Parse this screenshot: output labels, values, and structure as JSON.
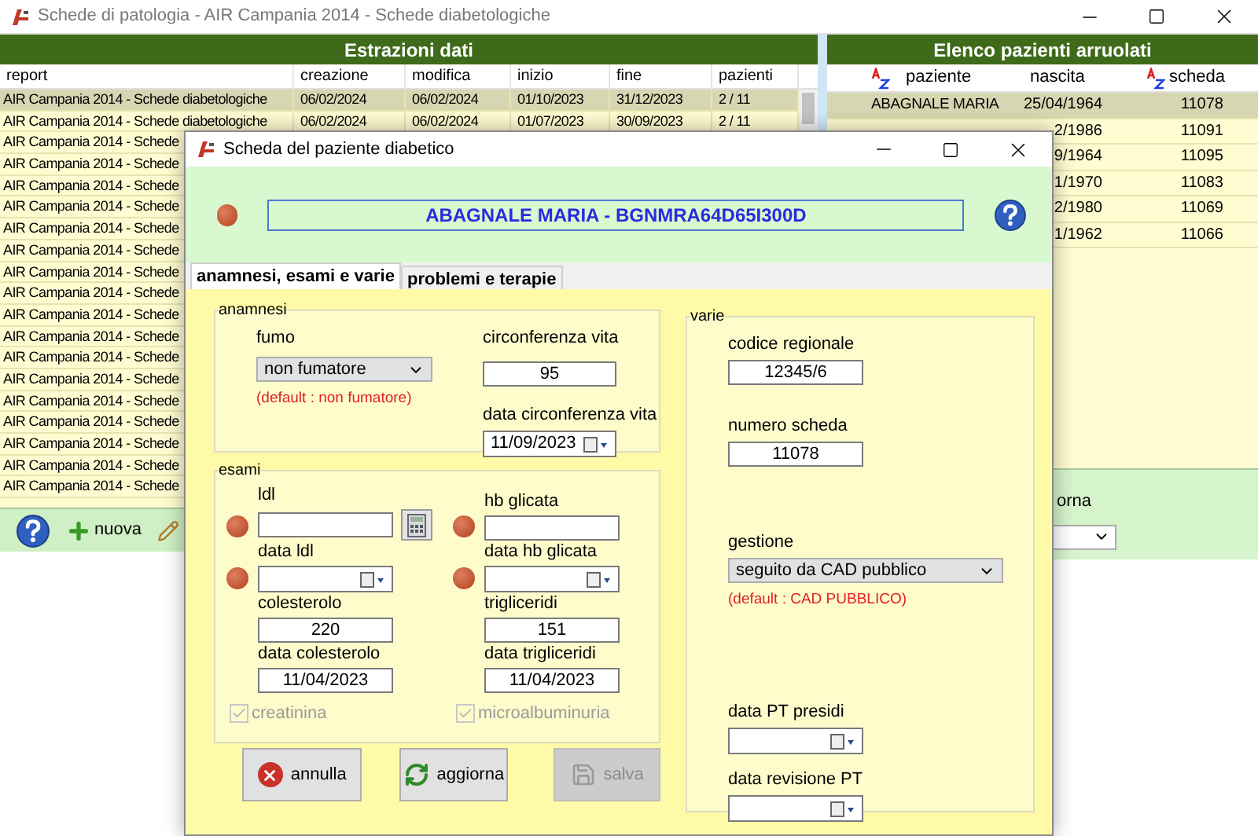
{
  "window": {
    "title": "Schede di patologia - AIR Campania 2014 - Schede diabetologiche"
  },
  "extractions": {
    "title": "Estrazioni dati",
    "columns": [
      "report",
      "creazione",
      "modifica",
      "inizio",
      "fine",
      "pazienti"
    ],
    "rows": [
      {
        "selected": true,
        "cells": [
          "AIR Campania 2014 - Schede diabetologiche",
          "06/02/2024",
          "06/02/2024",
          "01/10/2023",
          "31/12/2023",
          "2 / 11"
        ]
      },
      {
        "selected": false,
        "cells": [
          "AIR Campania 2014 - Schede diabetologiche",
          "06/02/2024",
          "06/02/2024",
          "01/07/2023",
          "30/09/2023",
          "2 / 11"
        ]
      },
      {
        "selected": false,
        "cells": [
          "AIR Campania 2014 - Schede"
        ]
      },
      {
        "selected": false,
        "cells": [
          "AIR Campania 2014 - Schede"
        ]
      },
      {
        "selected": false,
        "cells": [
          "AIR Campania 2014 - Schede"
        ]
      },
      {
        "selected": false,
        "cells": [
          "AIR Campania 2014 - Schede"
        ]
      },
      {
        "selected": false,
        "cells": [
          "AIR Campania 2014 - Schede"
        ]
      },
      {
        "selected": false,
        "cells": [
          "AIR Campania 2014 - Schede"
        ]
      },
      {
        "selected": false,
        "cells": [
          "AIR Campania 2014 - Schede"
        ]
      },
      {
        "selected": false,
        "cells": [
          "AIR Campania 2014 - Schede"
        ]
      },
      {
        "selected": false,
        "cells": [
          "AIR Campania 2014 - Schede"
        ]
      },
      {
        "selected": false,
        "cells": [
          "AIR Campania 2014 - Schede"
        ]
      },
      {
        "selected": false,
        "cells": [
          "AIR Campania 2014 - Schede"
        ]
      },
      {
        "selected": false,
        "cells": [
          "AIR Campania 2014 - Schede"
        ]
      },
      {
        "selected": false,
        "cells": [
          "AIR Campania 2014 - Schede"
        ]
      },
      {
        "selected": false,
        "cells": [
          "AIR Campania 2014 - Schede"
        ]
      },
      {
        "selected": false,
        "cells": [
          "AIR Campania 2014 - Schede"
        ]
      },
      {
        "selected": false,
        "cells": [
          "AIR Campania 2014 - Schede"
        ]
      },
      {
        "selected": false,
        "cells": [
          "AIR Campania 2014 - Schede"
        ]
      }
    ]
  },
  "toolbar": {
    "items": [
      {
        "kind": "help"
      },
      {
        "kind": "new",
        "label": "nuova"
      },
      {
        "kind": "edit"
      }
    ]
  },
  "patients": {
    "title": "Elenco pazienti arruolati",
    "columns": [
      "paziente",
      "nascita",
      "scheda"
    ],
    "rows": [
      {
        "selected": true,
        "paziente": "ABAGNALE MARIA",
        "nascita": "25/04/1964",
        "scheda": "11078"
      },
      {
        "selected": false,
        "nascita": "2/1986",
        "scheda": "11091"
      },
      {
        "selected": false,
        "nascita": "9/1964",
        "scheda": "11095"
      },
      {
        "selected": false,
        "nascita": "1/1970",
        "scheda": "11083"
      },
      {
        "selected": false,
        "nascita": "2/1980",
        "scheda": "11069"
      },
      {
        "selected": false,
        "nascita": "1/1962",
        "scheda": "11066"
      }
    ]
  },
  "patients_footer": {
    "label": "orna"
  },
  "dialog": {
    "title": "Scheda del paziente diabetico",
    "patient": "ABAGNALE MARIA - BGNMRA64D65I300D",
    "tabs": [
      {
        "label": "anamnesi, esami e varie",
        "selected": true
      },
      {
        "label": "problemi e terapie",
        "selected": false
      }
    ],
    "anamnesi": {
      "title": "anamnesi",
      "fumo": {
        "label": "fumo",
        "value": "non fumatore",
        "hint": "(default : non fumatore)"
      },
      "waist": {
        "label": "circonferenza vita",
        "value": "95"
      },
      "waist_date": {
        "label": "data circonferenza vita",
        "value": "11/09/2023"
      }
    },
    "esami": {
      "title": "esami",
      "fields": [
        {
          "kind": "input",
          "label": "ldl",
          "alert": true,
          "calculator": true
        },
        {
          "kind": "input",
          "label": "hb glicata",
          "alert": true,
          "calculator": false
        },
        {
          "kind": "date",
          "label": "data ldl",
          "alert": true,
          "calculator": false
        },
        {
          "kind": "date",
          "label": "data hb glicata",
          "alert": true,
          "calculator": false
        },
        {
          "kind": "input",
          "label": "colesterolo",
          "value": "220",
          "alert": false,
          "calculator": false
        },
        {
          "kind": "input",
          "label": "trigliceridi",
          "value": "151",
          "alert": false,
          "calculator": false
        },
        {
          "kind": "input",
          "label": "data colesterolo",
          "value": "11/04/2023",
          "alert": false,
          "calculator": false
        },
        {
          "kind": "input",
          "label": "data trigliceridi",
          "value": "11/04/2023",
          "alert": false,
          "calculator": false
        }
      ],
      "checks": [
        {
          "label": "creatinina",
          "checked": true,
          "disabled": true
        },
        {
          "label": "microalbuminuria",
          "checked": true,
          "disabled": true
        }
      ]
    },
    "varie": {
      "title": "varie",
      "groups": [
        [
          {
            "kind": "input",
            "label": "codice regionale",
            "value": "12345/6"
          },
          {
            "kind": "input",
            "label": "numero scheda",
            "value": "11078"
          }
        ],
        [
          {
            "kind": "select",
            "label": "gestione",
            "value": "seguito da CAD pubblico",
            "hint": "(default : CAD PUBBLICO)"
          }
        ],
        [
          {
            "kind": "date",
            "label": "data PT presidi"
          },
          {
            "kind": "date",
            "label": "data revisione PT"
          }
        ]
      ]
    },
    "buttons": [
      {
        "kind": "cancel",
        "label": "annulla",
        "disabled": false
      },
      {
        "kind": "refresh",
        "label": "aggiorna",
        "disabled": false
      },
      {
        "kind": "save",
        "label": "salva",
        "disabled": true
      }
    ]
  }
}
